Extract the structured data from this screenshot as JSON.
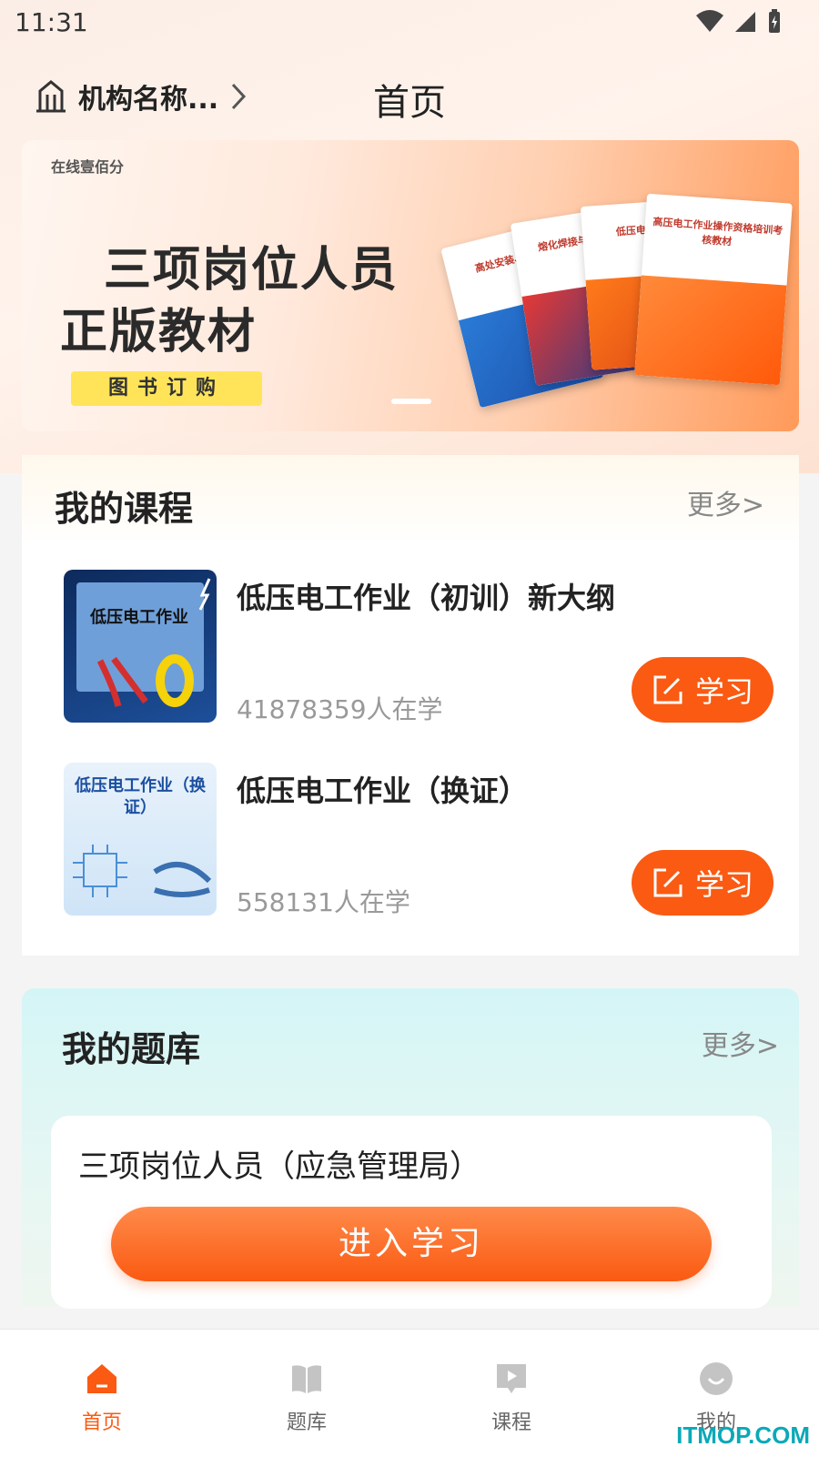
{
  "status_bar": {
    "time": "11:31"
  },
  "header": {
    "org_name": "机构名称...",
    "title": "首页"
  },
  "banner": {
    "brand": "在线壹佰分",
    "headline_1": "三项岗位人员",
    "headline_2": "正版教材",
    "order_label": "图书订购",
    "books": [
      "高处安装、维护",
      "熔化焊接与热切割",
      "低压电工作业",
      "高压电工作业操作资格培训考核教材"
    ]
  },
  "my_courses": {
    "title": "我的课程",
    "more": "更多>",
    "items": [
      {
        "title": "低压电工作业（初训）新大纲",
        "count": "41878359人在学",
        "thumb_text": "低压电工作业",
        "button": "学习"
      },
      {
        "title": "低压电工作业（换证）",
        "count": "558131人在学",
        "thumb_text": "低压电工作业（换证）",
        "button": "学习"
      }
    ]
  },
  "my_question_bank": {
    "title": "我的题库",
    "more": "更多>",
    "item_name": "三项岗位人员（应急管理局）",
    "enter_button": "进入学习"
  },
  "bottom_nav": [
    {
      "label": "首页",
      "active": true
    },
    {
      "label": "题库",
      "active": false
    },
    {
      "label": "课程",
      "active": false
    },
    {
      "label": "我的",
      "active": false
    }
  ],
  "watermark": "ITMOP.COM",
  "colors": {
    "accent": "#fa5a12",
    "teal": "#0aa9b8"
  }
}
